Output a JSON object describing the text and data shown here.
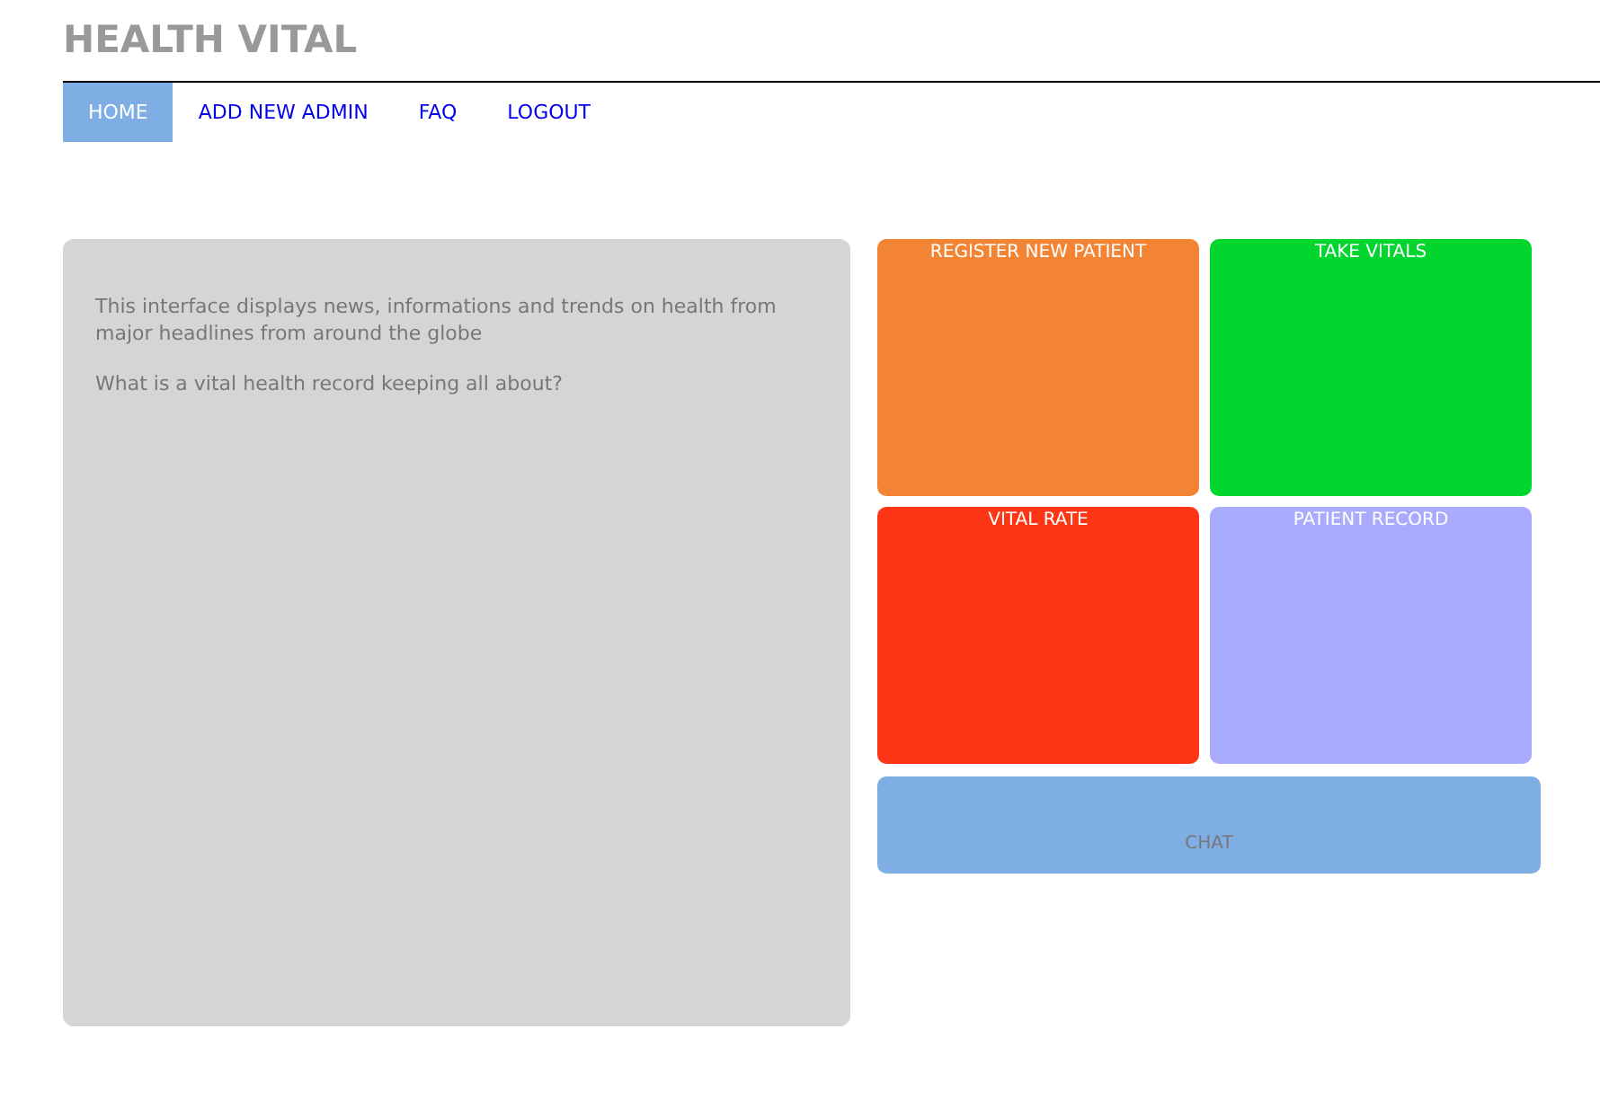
{
  "header": {
    "title": "HEALTH VITAL"
  },
  "nav": [
    {
      "label": "HOME",
      "selected": true
    },
    {
      "label": "ADD NEW ADMIN",
      "selected": false
    },
    {
      "label": "FAQ",
      "selected": false
    },
    {
      "label": "LOGOUT",
      "selected": false
    }
  ],
  "info_panel": {
    "paragraphs": [
      "This interface displays news, informations and trends on health from major headlines from around the globe",
      "What is a vital health record keeping all about?"
    ]
  },
  "tiles": [
    {
      "label": "REGISTER NEW PATIENT",
      "color": "#f28434"
    },
    {
      "label": "TAKE VITALS",
      "color": "#00d62e"
    },
    {
      "label": "VITAL RATE",
      "color": "#ff3616"
    },
    {
      "label": "PATIENT RECORD",
      "color": "#a9abfd"
    }
  ],
  "chat": {
    "label": "CHAT"
  }
}
